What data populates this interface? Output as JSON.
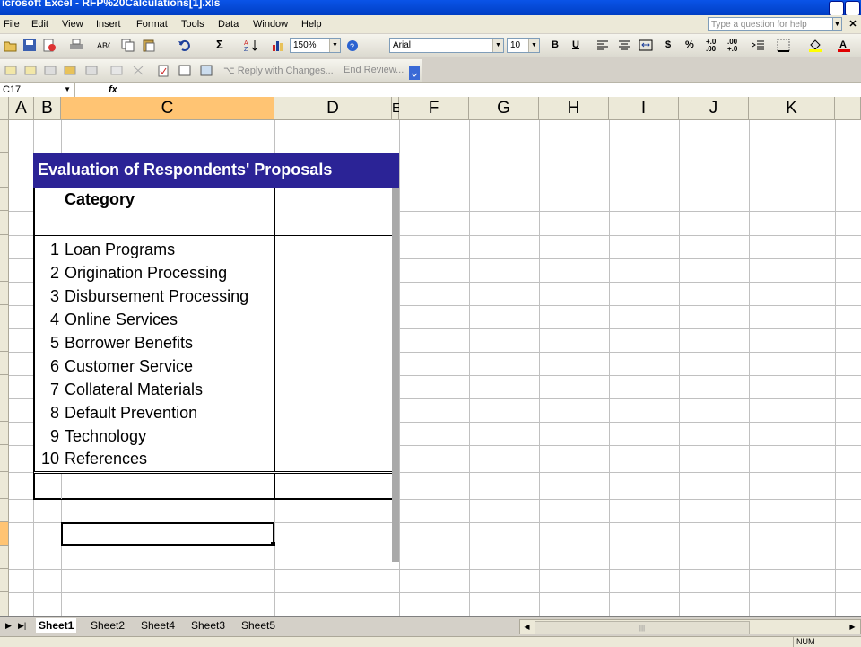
{
  "window": {
    "title": "icrosoft Excel - RFP%20Calculations[1].xls"
  },
  "menu": [
    "File",
    "Edit",
    "View",
    "Insert",
    "Format",
    "Tools",
    "Data",
    "Window",
    "Help"
  ],
  "ask_placeholder": "Type a question for help",
  "toolbar": {
    "zoom": "150%",
    "font": "Arial",
    "size": "10",
    "bold": "B",
    "underline": "U",
    "currency": "$",
    "percent": "%",
    "inc_decimal": "+.0 .00",
    "dec_decimal": ".00 +.0",
    "sigma": "Σ"
  },
  "reviewing": {
    "reply": "Reply with Changes...",
    "end": "End Review..."
  },
  "formula": {
    "name_box": "C17",
    "fx": "fx"
  },
  "columns": [
    "A",
    "B",
    "C",
    "D",
    "E",
    "F",
    "G",
    "H",
    "I",
    "J",
    "K"
  ],
  "sheet": {
    "title": "Evaluation of Respondents' Proposals",
    "category_header": "Category",
    "rows": [
      {
        "n": "1",
        "label": "Loan Programs"
      },
      {
        "n": "2",
        "label": "Origination Processing"
      },
      {
        "n": "3",
        "label": "Disbursement Processing"
      },
      {
        "n": "4",
        "label": "Online Services"
      },
      {
        "n": "5",
        "label": "Borrower Benefits"
      },
      {
        "n": "6",
        "label": "Customer Service"
      },
      {
        "n": "7",
        "label": "Collateral Materials"
      },
      {
        "n": "8",
        "label": "Default Prevention"
      },
      {
        "n": "9",
        "label": "Technology"
      },
      {
        "n": "10",
        "label": "References"
      }
    ]
  },
  "tabs": [
    "Sheet1",
    "Sheet2",
    "Sheet4",
    "Sheet3",
    "Sheet5"
  ],
  "status": {
    "num": "NUM"
  },
  "colors": {
    "header_fill": "#2b2396",
    "selected_header": "#ffc473"
  }
}
